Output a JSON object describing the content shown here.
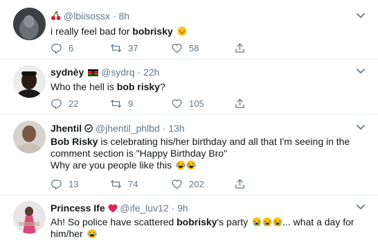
{
  "tweets": [
    {
      "name": "",
      "handle": "@lbiisossx",
      "time": "8h",
      "text_before": "i really feel bad for ",
      "text_bold": "bobrisky",
      "text_after": "",
      "replies": "6",
      "retweets": "37",
      "likes": "58"
    },
    {
      "name": "sydnèy",
      "handle": "@sydrq",
      "time": "22h",
      "text_before": "Who the hell is ",
      "text_bold": "bob risky",
      "text_after": "?",
      "replies": "22",
      "retweets": "9",
      "likes": "105"
    },
    {
      "name": "Jhentil",
      "handle": "@jhentil_phlbd",
      "time": "13h",
      "text_bold": "Bob Risky",
      "text_line1_after": " is celebrating his/her birthday and all that I'm seeing in the",
      "text_line2": "comment section is \"Happy Birthday Bro\"",
      "text_line3": "Why are you people like this",
      "replies": "13",
      "retweets": "74",
      "likes": "202"
    },
    {
      "name": "Princess Ife",
      "handle": "@ife_luv12",
      "time": "9h",
      "text_before": "Ah! So police have scattered ",
      "text_bold": "bobrisky",
      "text_after": "'s party",
      "text_after2": "... what a day for",
      "text_line2": "him/her"
    }
  ],
  "separator": "·",
  "icons": [
    "reply-icon",
    "retweet-icon",
    "like-icon",
    "share-icon",
    "chevron-down-icon",
    "cherries-icon",
    "kenya-flag-icon",
    "verified-icon",
    "heart-emoji",
    "pensive-emoji",
    "tears-of-joy-emoji",
    "crying-emoji"
  ]
}
